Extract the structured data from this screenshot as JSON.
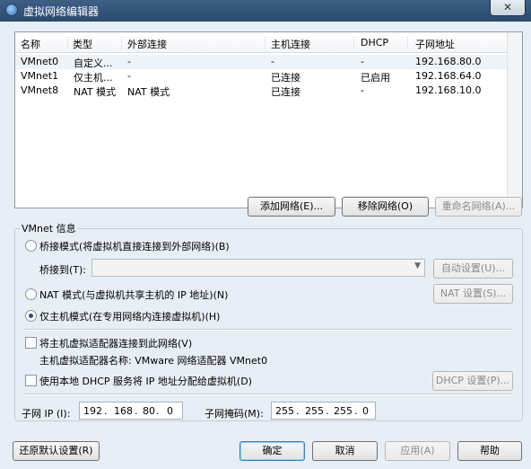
{
  "window": {
    "title": "虚拟网络编辑器",
    "close_glyph": "✕"
  },
  "table": {
    "columns": [
      "名称",
      "类型",
      "外部连接",
      "主机连接",
      "DHCP",
      "子网地址"
    ],
    "rows": [
      {
        "name": "VMnet0",
        "type": "自定义...",
        "external": "-",
        "host": "-",
        "dhcp": "-",
        "subnet": "192.168.80.0"
      },
      {
        "name": "VMnet1",
        "type": "仅主机...",
        "external": "-",
        "host": "已连接",
        "dhcp": "已启用",
        "subnet": "192.168.64.0"
      },
      {
        "name": "VMnet8",
        "type": "NAT 模式",
        "external": "NAT 模式",
        "host": "已连接",
        "dhcp": "-",
        "subnet": "192.168.10.0"
      }
    ]
  },
  "list_buttons": {
    "add": "添加网络(E)...",
    "remove": "移除网络(O)",
    "rename": "重命名网络(A)..."
  },
  "vmnet_info": {
    "label": "VMnet 信息",
    "bridged": {
      "label": "桥接模式(将虚拟机直接连接到外部网络)(B)",
      "bridge_to_label": "桥接到(T):",
      "bridge_to_value": "",
      "auto_button": "自动设置(U)..."
    },
    "nat": {
      "label": "NAT 模式(与虚拟机共享主机的 IP 地址)(N)",
      "settings_button": "NAT 设置(S)..."
    },
    "host_only": {
      "label": "仅主机模式(在专用网络内连接虚拟机)(H)"
    },
    "connect_adapter": {
      "label": "将主机虚拟适配器连接到此网络(V)",
      "adapter_name_label": "主机虚拟适配器名称: VMware 网络适配器 VMnet0"
    },
    "dhcp": {
      "label": "使用本地 DHCP 服务将 IP 地址分配给虚拟机(D)",
      "settings_button": "DHCP 设置(P)..."
    },
    "subnet_ip": {
      "label": "子网 IP (I):",
      "octets": [
        "192",
        "168",
        "80",
        "0"
      ]
    },
    "subnet_mask": {
      "label": "子网掩码(M):",
      "octets": [
        "255",
        "255",
        "255",
        "0"
      ]
    }
  },
  "footer": {
    "restore": "还原默认设置(R)",
    "ok": "确定",
    "cancel": "取消",
    "apply": "应用(A)",
    "help": "帮助"
  }
}
